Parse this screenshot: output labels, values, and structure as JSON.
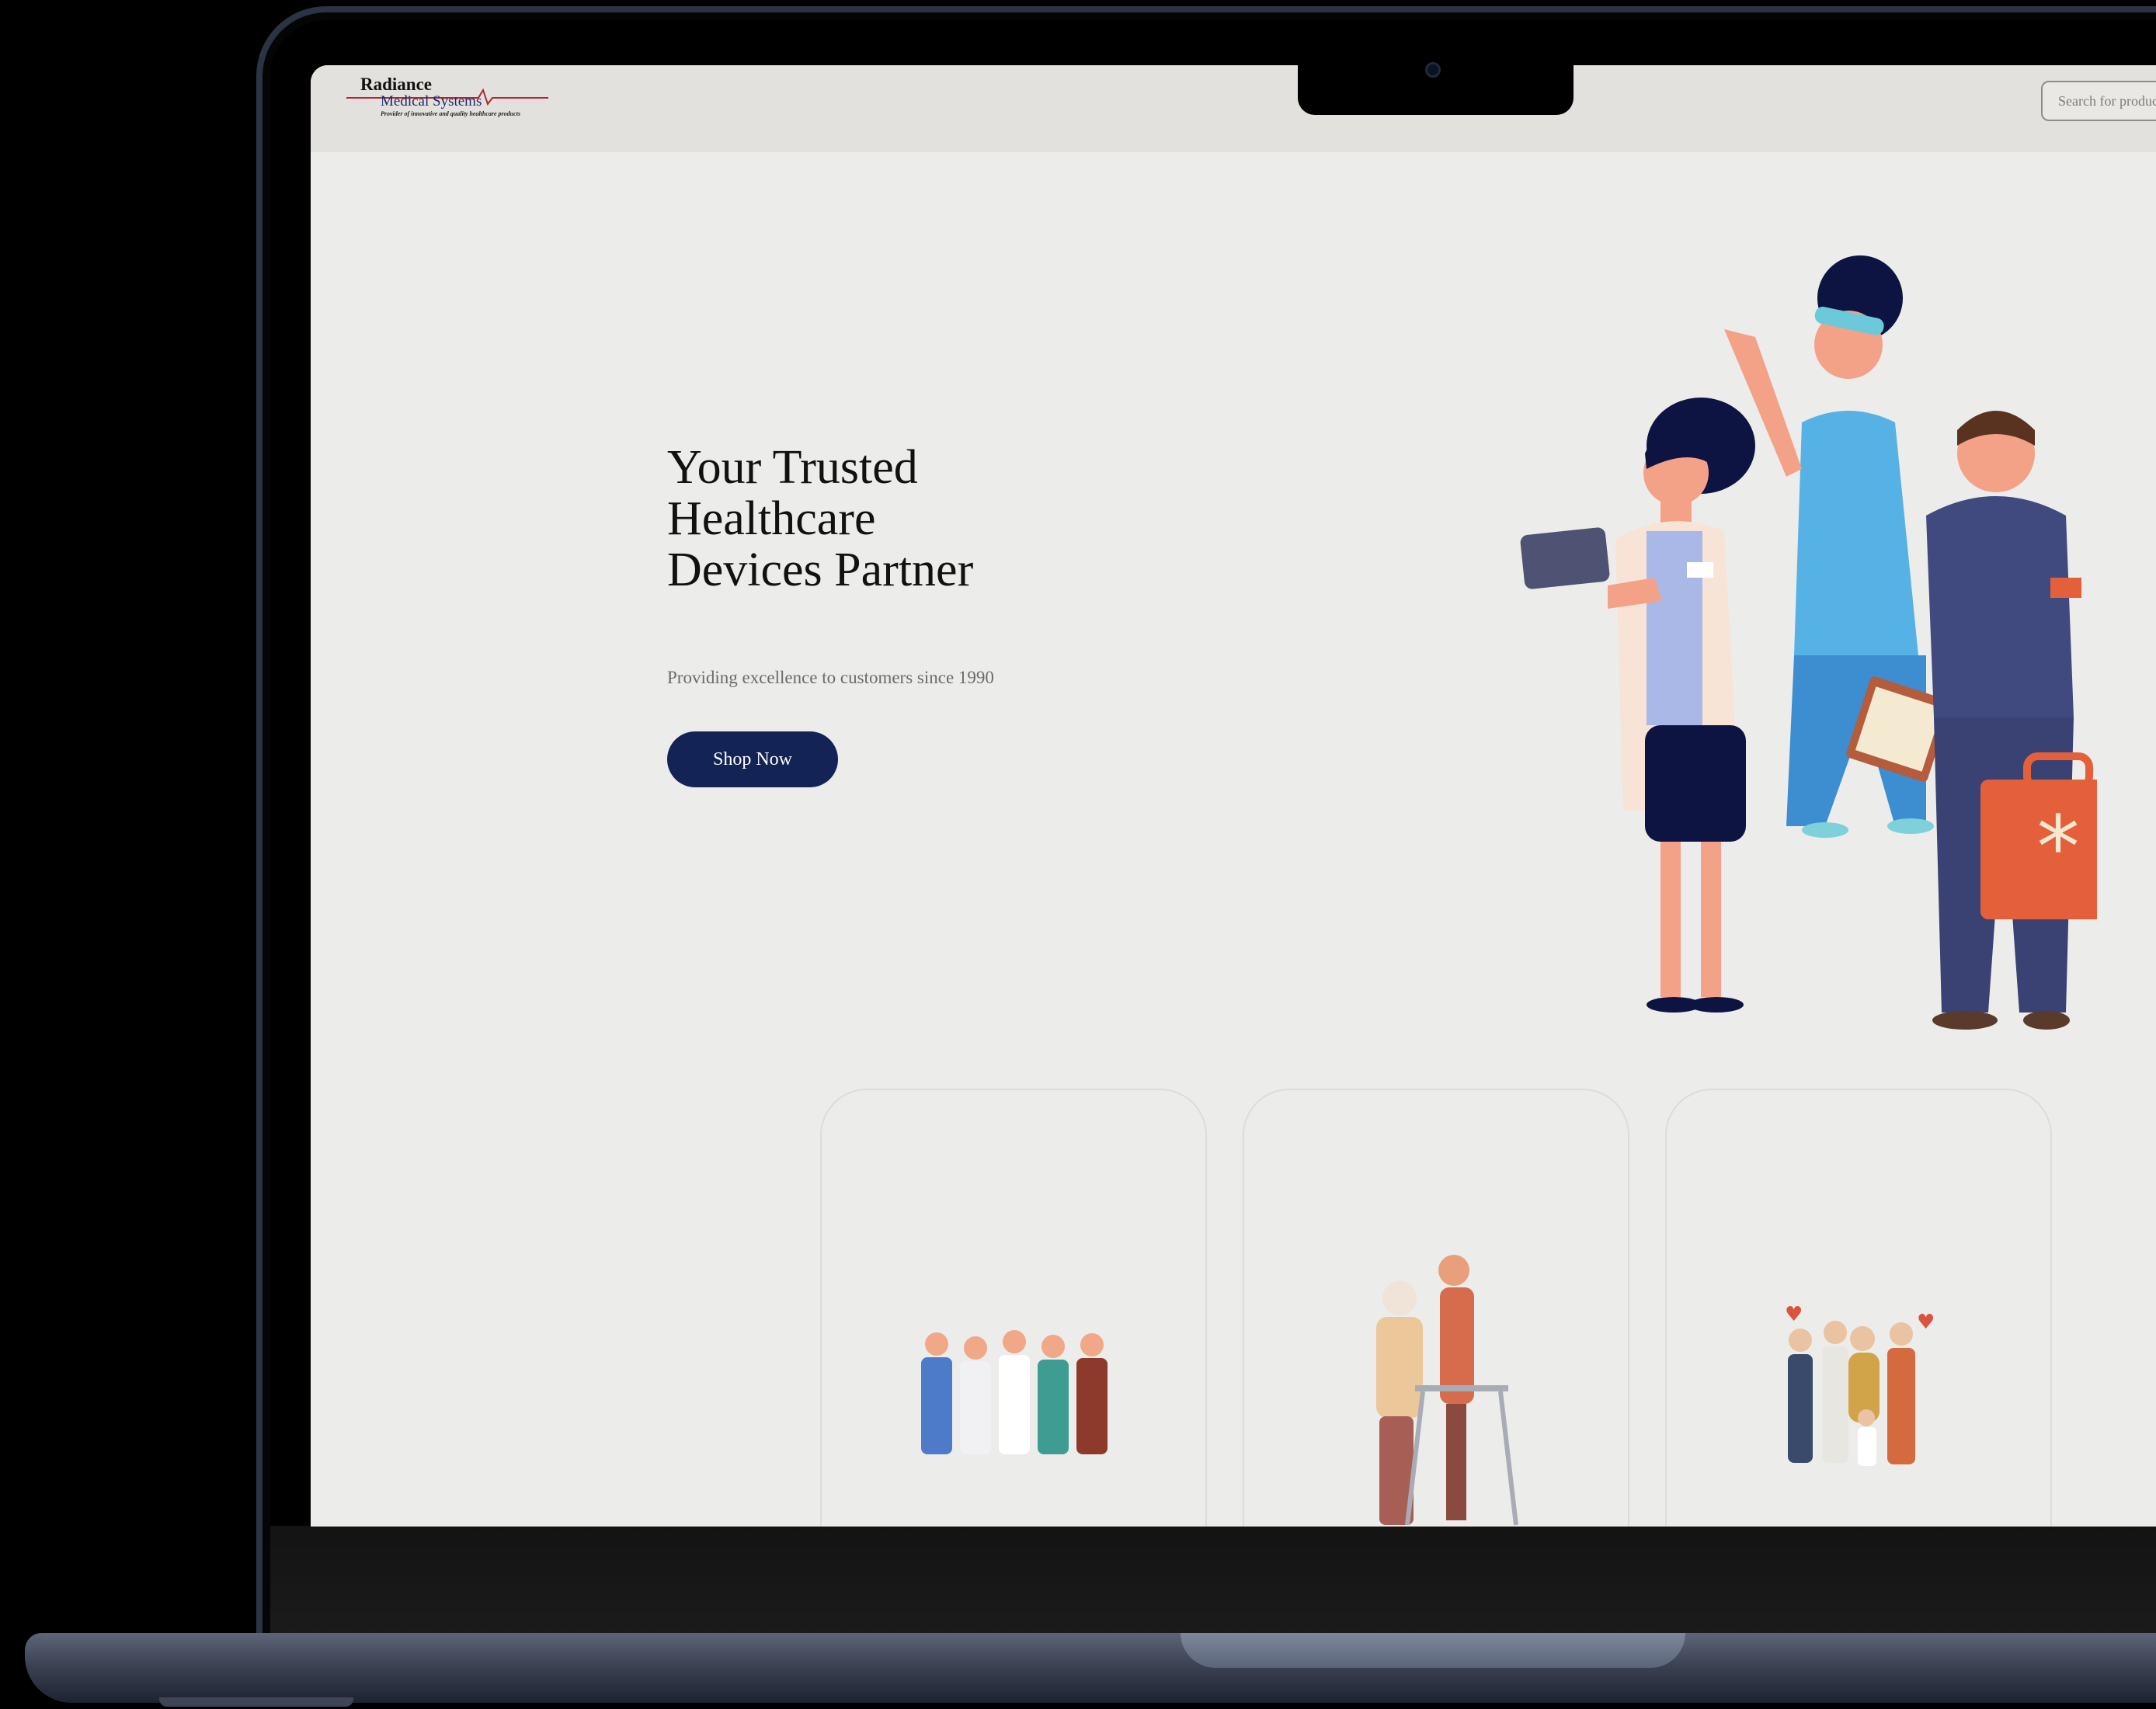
{
  "header": {
    "logo": {
      "line1": "Radiance",
      "line2": "Medical Systems",
      "tagline": "Provider of innovative and quality healthcare products"
    },
    "search": {
      "placeholder": "Search for products"
    }
  },
  "hero": {
    "title": "Your Trusted Healthcare Devices Partner",
    "subtitle": "Providing excellence to customers since 1990",
    "cta_label": "Shop Now",
    "illustration": "doctor-nurse-paramedic-illustration"
  },
  "cards": [
    {
      "illustration": "medical-team-illustration"
    },
    {
      "illustration": "elderly-care-walker-illustration"
    },
    {
      "illustration": "family-group-illustration"
    }
  ],
  "colors": {
    "page_bg": "#ececea",
    "header_bg": "#e2e1de",
    "primary_button": "#142356",
    "laptop_body": "#3b4354"
  }
}
